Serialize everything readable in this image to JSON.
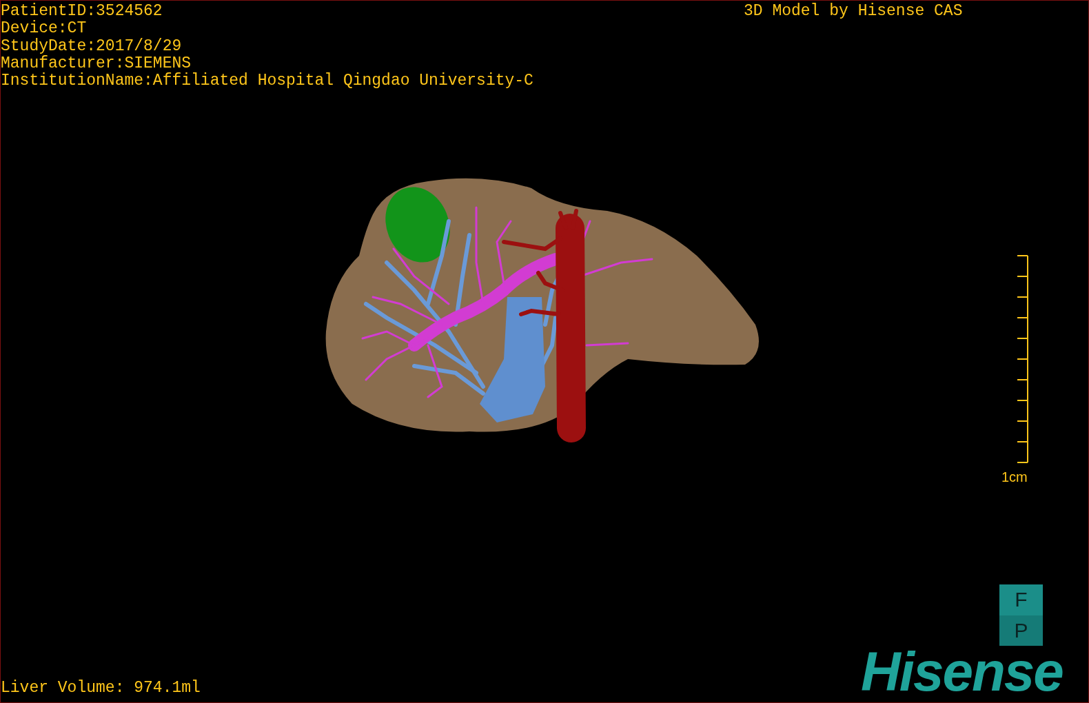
{
  "study_info": [
    "PatientID:3524562",
    "Device:CT",
    "StudyDate:2017/8/29",
    "Manufacturer:SIEMENS",
    "InstitutionName:Affiliated Hospital Qingdao University-C"
  ],
  "title": "3D Model by Hisense CAS",
  "scale_label": "1cm",
  "orientation_faces": [
    "F",
    "P"
  ],
  "logo": "Hisense",
  "liver_volume": "Liver Volume: 974.1ml"
}
